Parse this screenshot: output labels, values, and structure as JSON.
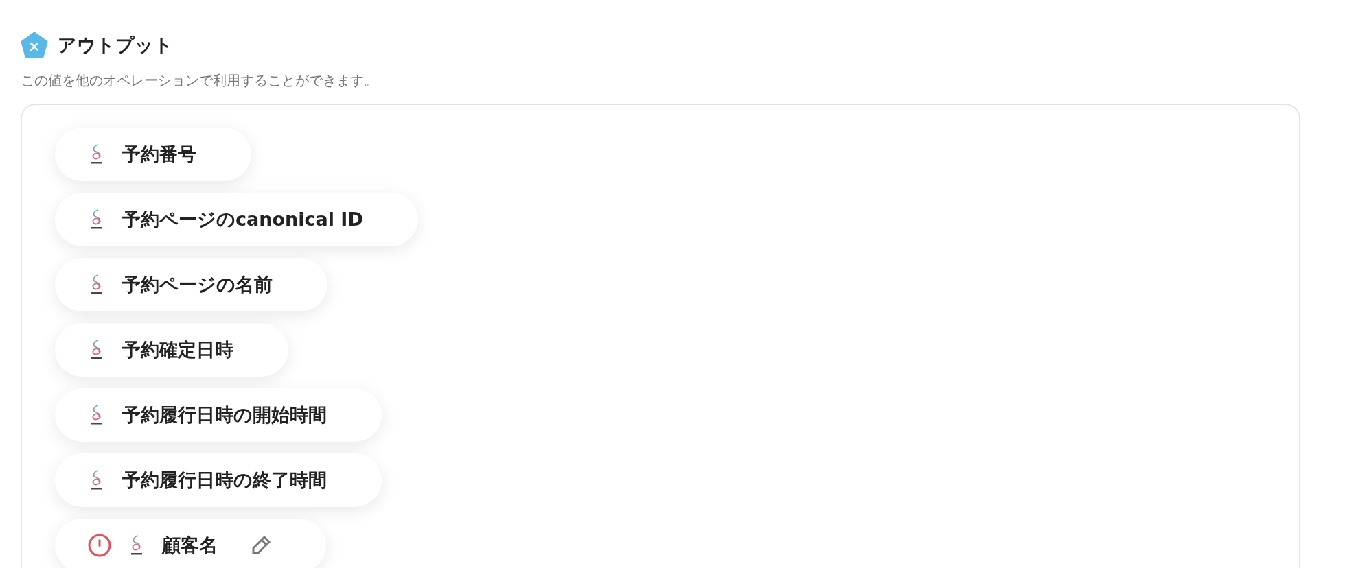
{
  "section": {
    "title": "アウトプット",
    "description": "この値を他のオペレーションで利用することができます。"
  },
  "outputs": [
    {
      "label": "予約番号",
      "warning": false,
      "editable": false
    },
    {
      "label": "予約ページのcanonical ID",
      "warning": false,
      "editable": false
    },
    {
      "label": "予約ページの名前",
      "warning": false,
      "editable": false
    },
    {
      "label": "予約確定日時",
      "warning": false,
      "editable": false
    },
    {
      "label": "予約履行日時の開始時間",
      "warning": false,
      "editable": false
    },
    {
      "label": "予約履行日時の終了時間",
      "warning": false,
      "editable": false
    },
    {
      "label": "顧客名",
      "warning": true,
      "editable": true
    }
  ]
}
